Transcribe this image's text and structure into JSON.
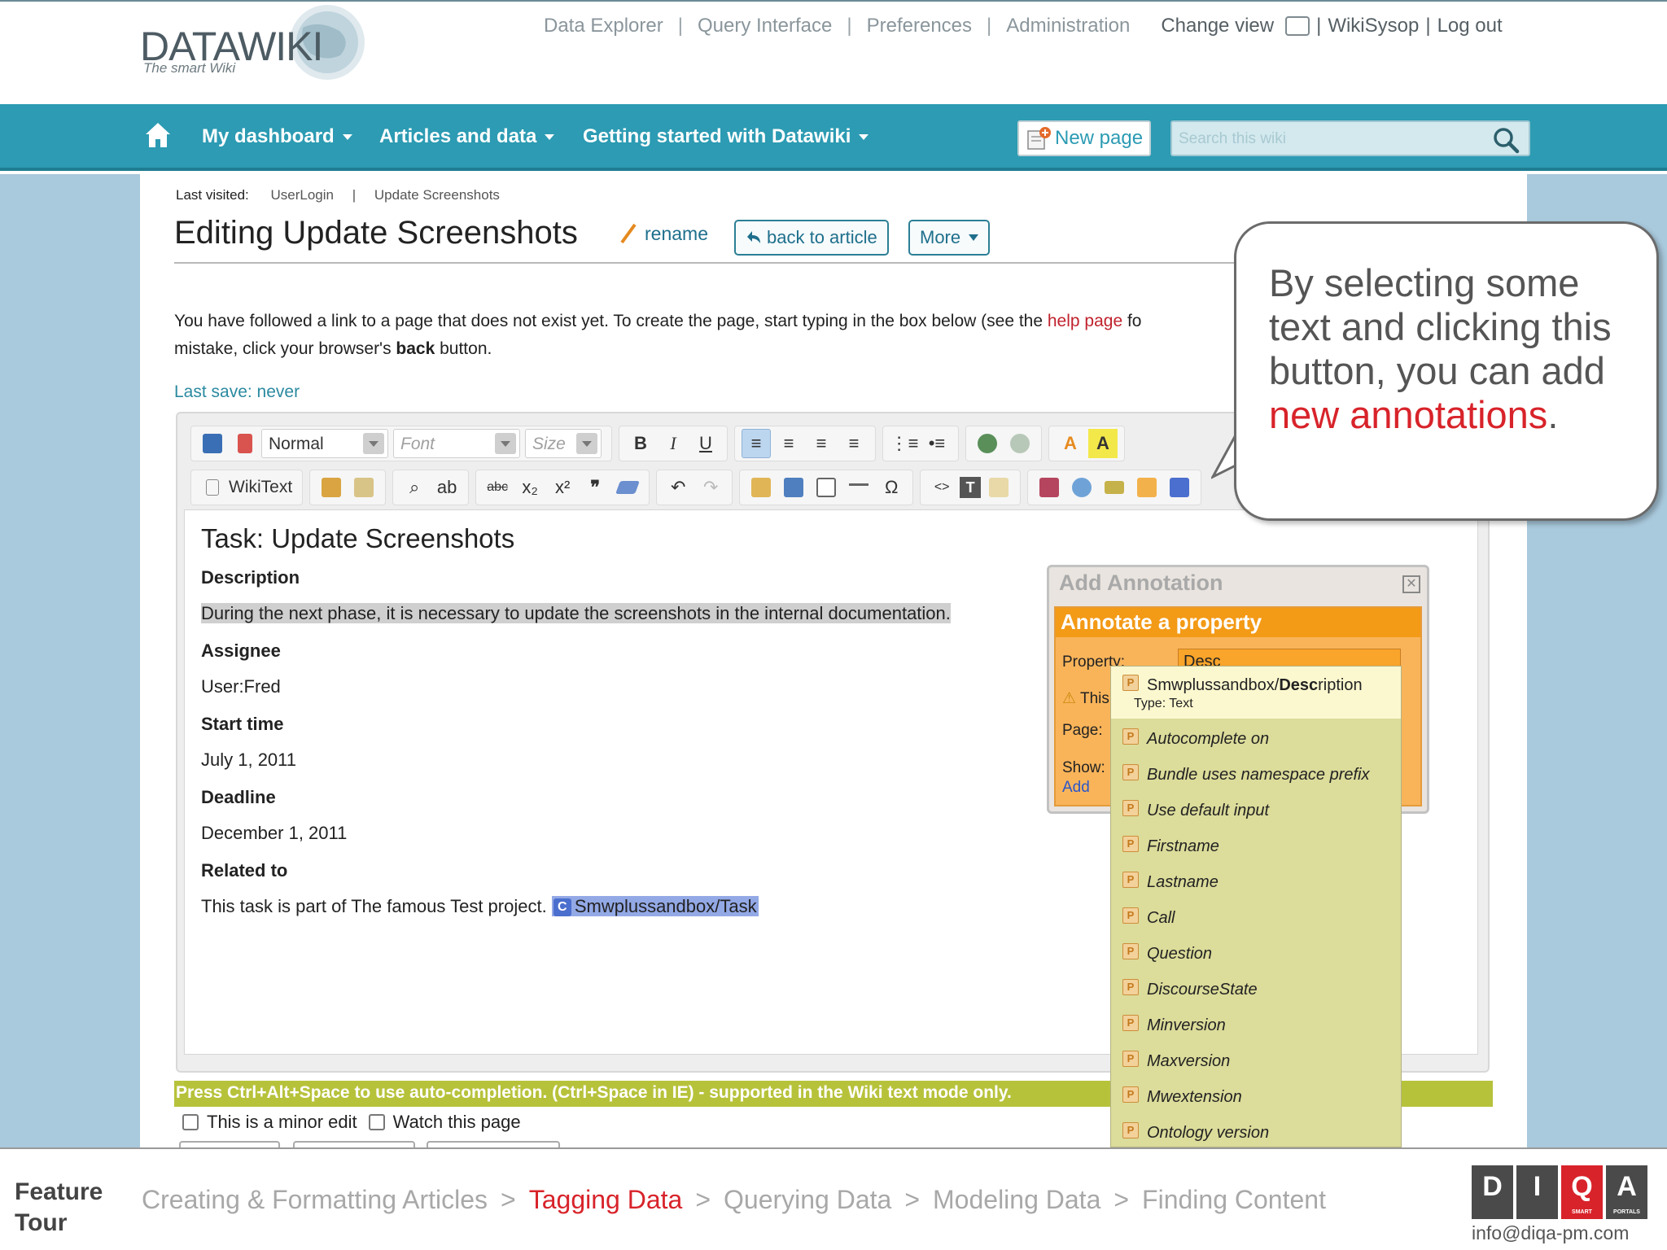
{
  "logo": {
    "title": "DATAWIKI",
    "subtitle": "The smart Wiki"
  },
  "toplinks": {
    "data_explorer": "Data Explorer",
    "query_interface": "Query Interface",
    "preferences": "Preferences",
    "administration": "Administration",
    "change_view": "Change view",
    "user": "WikiSysop",
    "logout": "Log out",
    "separator": "|"
  },
  "nav": {
    "dashboard": "My dashboard",
    "articles": "Articles and data",
    "getting_started": "Getting started with Datawiki",
    "new_page": "New page",
    "search_placeholder": "Search this wiki"
  },
  "breadcrumb": {
    "label": "Last visited:",
    "items": [
      "UserLogin",
      "Update Screenshots"
    ],
    "separator": "|"
  },
  "page": {
    "title": "Editing Update Screenshots",
    "rename": "rename",
    "back": "back to article",
    "more": "More",
    "intro_1": "You have followed a link to a page that does not exist yet. To create the page, start typing in the box below (see the ",
    "help_link": "help page",
    "intro_2": " fo",
    "intro_3": "mistake, click your browser's ",
    "intro_back": "back",
    "intro_4": " button.",
    "last_save": "Last save: never"
  },
  "toolbar": {
    "format_select": "Normal",
    "font_select": "Font",
    "size_select": "Size",
    "wikitext": "WikiText",
    "bold": "B",
    "italic": "I",
    "underline": "U"
  },
  "editor": {
    "heading": "Task: Update Screenshots",
    "sections": [
      {
        "label": "Description",
        "value": "During the next phase, it is necessary to update the screenshots in the internal documentation."
      },
      {
        "label": "Assignee",
        "value": "User:Fred"
      },
      {
        "label": "Start time",
        "value": "July 1, 2011"
      },
      {
        "label": "Deadline",
        "value": "December 1, 2011"
      },
      {
        "label": "Related to",
        "value": "This task is part of The famous Test project.",
        "tag": "Smwplussandbox/Task",
        "tag_badge": "C"
      }
    ]
  },
  "autocompletion_hint": "Press Ctrl+Alt+Space to use auto-completion. (Ctrl+Space in IE) - supported in the Wiki text mode only.",
  "checkboxes": {
    "minor_edit": "This is a minor edit",
    "watch": "Watch this page"
  },
  "annotation": {
    "dialog_title": "Add Annotation",
    "header": "Annotate a property",
    "property_label": "Property:",
    "property_value": "Desc",
    "warning_text": "This",
    "page_label": "Page:",
    "show_label": "Show:",
    "add_link": "Add",
    "close_symbol": "✕"
  },
  "suggestions": {
    "first_prefix": "Smwplussandbox/",
    "first_match": "Desc",
    "first_suffix": "ription",
    "first_type": "Type: Text",
    "icon_letter": "P",
    "items": [
      "Autocomplete on",
      "Bundle uses namespace prefix",
      "Use default input",
      "Firstname",
      "Lastname",
      "Call",
      "Question",
      "DiscourseState",
      "Minversion",
      "Maxversion",
      "Mwextension",
      "Ontology version"
    ]
  },
  "callout": {
    "text_1": "By selecting some text and clicking this button, you can add ",
    "text_red": "new annotations",
    "text_2": "."
  },
  "footer": {
    "label_1": "Feature",
    "label_2": "Tour",
    "steps": [
      "Creating & Formatting Articles",
      "Tagging Data",
      "Querying Data",
      "Modeling Data",
      "Finding Content"
    ],
    "active_step": "Tagging Data",
    "arrow": ">",
    "brand_letters": [
      "D",
      "I",
      "Q",
      "A"
    ],
    "brand_sub_1": "SMART",
    "brand_sub_2": "PORTALS",
    "email": "info@diqa-pm.com"
  },
  "colors": {
    "nav_bg": "#2c9bb3",
    "side_bg": "#a9c9dc",
    "accent_red": "#d8232a",
    "annot_orange": "#f39a16",
    "suggest_bg": "#dcdc9b"
  }
}
